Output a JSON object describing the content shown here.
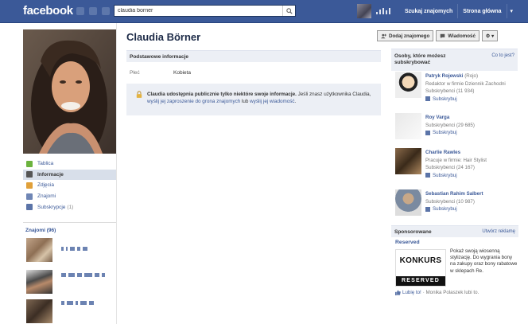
{
  "topbar": {
    "logo": "facebook",
    "search_value": "claudia borner",
    "find_friends": "Szukaj znajomych",
    "home": "Strona główna",
    "arrow": "▾"
  },
  "profile": {
    "name": "Claudia Börner"
  },
  "actions": {
    "add_friend": "Dodaj znajomego",
    "message": "Wiadomość",
    "gear": "⚙ ▾"
  },
  "left_nav": [
    {
      "label": "Tablica",
      "icon": "wall-icon",
      "color": "#6cb33e"
    },
    {
      "label": "Informacje",
      "icon": "info-icon",
      "color": "#555555"
    },
    {
      "label": "Zdjęcia",
      "icon": "photos-icon",
      "color": "#e0a03a"
    },
    {
      "label": "Znajomi",
      "icon": "friends-icon",
      "color": "#6f86b5"
    },
    {
      "label": "Subskrypcje",
      "count": "(1)",
      "icon": "subscriptions-icon",
      "color": "#5b74a8"
    }
  ],
  "friends": {
    "title": "Znajomi (96)"
  },
  "basic_info": {
    "header": "Podstawowe informacje",
    "gender_label": "Płeć",
    "gender_value": "Kobieta"
  },
  "notice": {
    "bold": "Claudia udostępnia publicznie tylko niektóre swoje informacje.",
    "text1": " Jeśli znasz użytkownika Claudia, ",
    "link1": "wyślij jej zaproszenie do grona znajomych",
    "text2": " lub ",
    "link2": "wyślij jej wiadomość",
    "text3": "."
  },
  "subscribers": {
    "title": "Osoby, które możesz subskrybować",
    "what": "Co to jest?",
    "items": [
      {
        "name": "Patryk Rojewski",
        "nick": "(Rojo)",
        "line1": "Redaktor w firmie Dziennik Zachodni",
        "line2": "Subskrybenci (11 934)",
        "button": "Subskrybuj"
      },
      {
        "name": "Roy Varga",
        "nick": "",
        "line1": "Subskrybenci (29 685)",
        "line2": "",
        "button": "Subskrybuj"
      },
      {
        "name": "Charlie Rawles",
        "nick": "",
        "line1": "Pracuje w firmie: Hair Stylist",
        "line2": "Subskrybenci (24 167)",
        "button": "Subskrybuj"
      },
      {
        "name": "Sebastian Rahim Salbert",
        "nick": "",
        "line1": "Subskrybenci (10 987)",
        "line2": "",
        "button": "Subskrybuj"
      }
    ]
  },
  "sponsored": {
    "title": "Sponsorowane",
    "create_ad": "Utwórz reklamę",
    "ad_title": "Reserved",
    "ad_image_top": "KONKURS",
    "ad_image_bottom": "RESERVED",
    "ad_text": "Pokaż swoją wiosenną stylizację. Do wygrania bony na zakupy oraz bony rabatowe w sklepach Re.",
    "like_link": "Lubię to!",
    "like_text": " · Monika Polaszek lubi to."
  }
}
